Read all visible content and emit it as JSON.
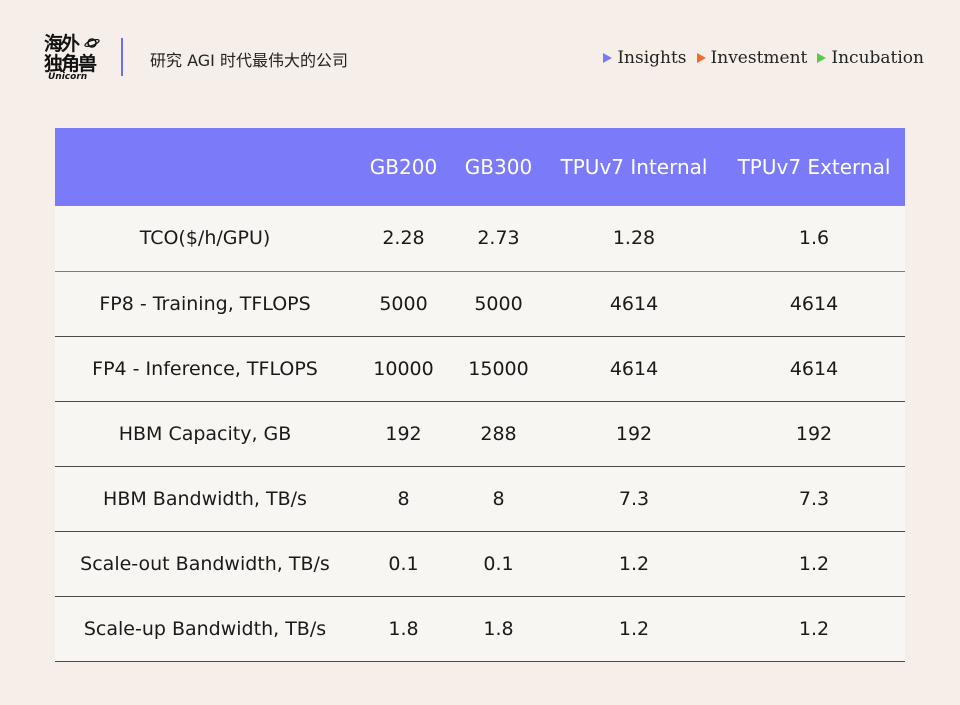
{
  "brand": {
    "logo_text_line1": "海外",
    "logo_text_line2": "独角兽",
    "logo_sub": "Unicorn",
    "slogan": "研究 AGI 时代最伟大的公司"
  },
  "nav": {
    "items": [
      {
        "label": "Insights",
        "color": "#7b7af5"
      },
      {
        "label": "Investment",
        "color": "#f26a2e"
      },
      {
        "label": "Incubation",
        "color": "#5cc94a"
      }
    ]
  },
  "table": {
    "header_color": "#7b7af8",
    "columns": [
      "",
      "GB200",
      "GB300",
      "TPUv7 Internal",
      "TPUv7 External"
    ],
    "rows": [
      [
        "TCO($/h/GPU)",
        "2.28",
        "2.73",
        "1.28",
        "1.6"
      ],
      [
        "FP8 - Training, TFLOPS",
        "5000",
        "5000",
        "4614",
        "4614"
      ],
      [
        "FP4 - Inference, TFLOPS",
        "10000",
        "15000",
        "4614",
        "4614"
      ],
      [
        "HBM Capacity, GB",
        "192",
        "288",
        "192",
        "192"
      ],
      [
        "HBM Bandwidth, TB/s",
        "8",
        "8",
        "7.3",
        "7.3"
      ],
      [
        "Scale-out Bandwidth, TB/s",
        "0.1",
        "0.1",
        "1.2",
        "1.2"
      ],
      [
        "Scale-up Bandwidth, TB/s",
        "1.8",
        "1.8",
        "1.2",
        "1.2"
      ]
    ]
  }
}
